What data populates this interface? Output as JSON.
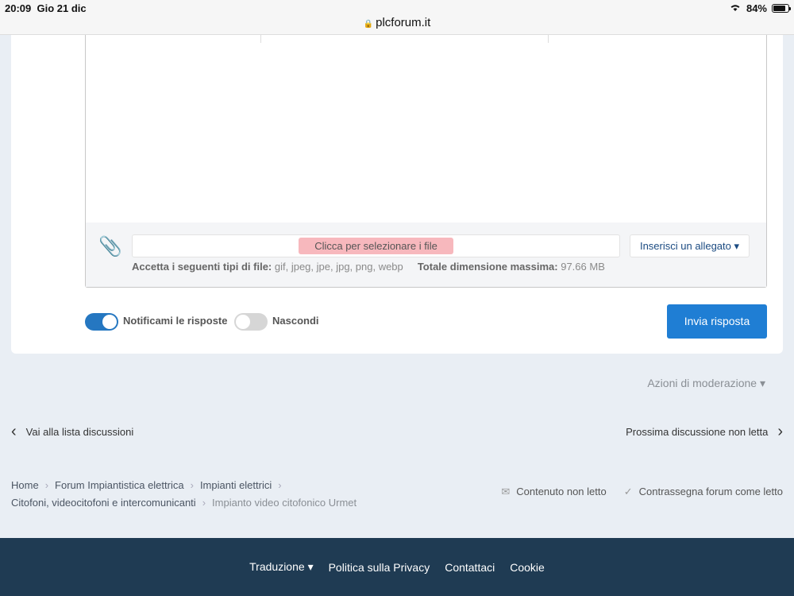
{
  "status": {
    "time": "20:09",
    "date": "Gio 21 dic",
    "url": "plcforum.it",
    "battery": "84%",
    "battery_level": 0.84
  },
  "attachments": {
    "select_files": "Clicca per selezionare i file",
    "insert_button": "Inserisci un allegato",
    "accepted_label": "Accetta i seguenti tipi di file:",
    "accepted_types": "gif, jpeg, jpe, jpg, png, webp",
    "max_size_label": "Totale dimensione massima:",
    "max_size": "97.66 MB"
  },
  "options": {
    "notify_label": "Notificami le risposte",
    "notify_on": true,
    "hide_label": "Nascondi",
    "hide_on": false
  },
  "submit_label": "Invia risposta",
  "moderation": "Azioni di moderazione",
  "nav": {
    "prev": "Vai alla lista discussioni",
    "next": "Prossima discussione non letta"
  },
  "breadcrumb": [
    "Home",
    "Forum Impiantistica elettrica",
    "Impianti elettrici",
    "Citofoni, videocitofoni e intercomunicanti",
    "Impianto video citofonico Urmet"
  ],
  "side_links": {
    "unread": "Contenuto non letto",
    "mark_read": "Contrassegna forum come letto"
  },
  "footer": {
    "translation": "Traduzione",
    "privacy": "Politica sulla Privacy",
    "contact": "Contattaci",
    "cookie": "Cookie"
  },
  "icons": {
    "lock": "lock-icon",
    "wifi": "wifi-icon",
    "clip": "paperclip-icon",
    "caret": "caret-down-icon",
    "chev_left": "chevron-left-icon",
    "chev_right": "chevron-right-icon",
    "unread": "envelope-icon",
    "check": "check-icon"
  }
}
